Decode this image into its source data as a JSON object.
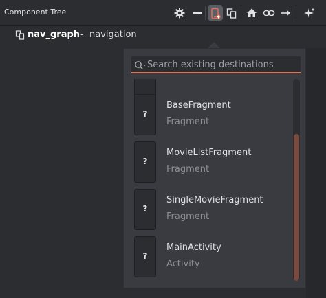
{
  "panel": {
    "title": "Component Tree"
  },
  "toolbar": {
    "icons": [
      "gear-icon",
      "minimize-icon",
      "new-destination-icon",
      "copy-icon",
      "home-icon",
      "link-icon",
      "arrow-right-icon",
      "sparkle-icon"
    ]
  },
  "tree": {
    "name": "nav_graph",
    "separator": "-",
    "description": "navigation"
  },
  "popup": {
    "search_placeholder": "Search existing destinations",
    "search_value": "",
    "accent_color": "#d6775c",
    "destinations": [
      {
        "name": "BaseFragment",
        "type": "Fragment",
        "thumb": "?"
      },
      {
        "name": "MovieListFragment",
        "type": "Fragment",
        "thumb": "?"
      },
      {
        "name": "SingleMovieFragment",
        "type": "Fragment",
        "thumb": "?"
      },
      {
        "name": "MainActivity",
        "type": "Activity",
        "thumb": "?"
      }
    ]
  }
}
